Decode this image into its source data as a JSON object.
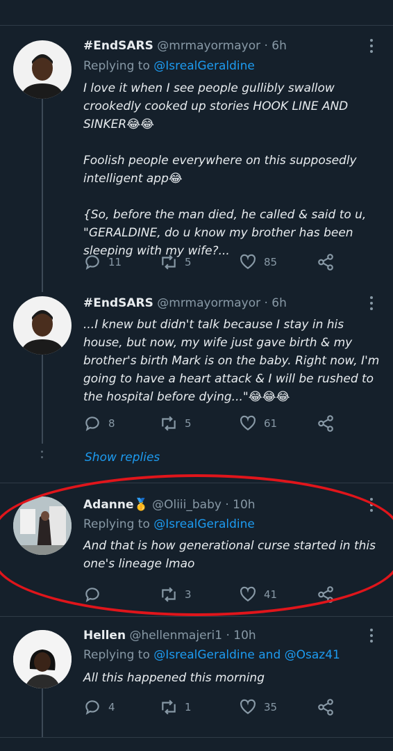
{
  "tweets": [
    {
      "name": "#EndSARS",
      "handle": "@mrmayormayor",
      "time": "· 6h",
      "replying_prefix": "Replying to",
      "replying_to": "@IsrealGeraldine",
      "replying_to_2": "",
      "body": "I love it when I see people gullibly swallow crookedly cooked up stories HOOK LINE AND SINKER😂😂\n\nFoolish people everywhere on this supposedly intelligent app😂\n\n{So, before the man died, he called & said to u, \"GERALDINE, do u know my brother has been sleeping with my wife?...",
      "replies": "11",
      "retweets": "5",
      "likes": "85"
    },
    {
      "name": "#EndSARS",
      "handle": "@mrmayormayor",
      "time": "· 6h",
      "body": "...I knew but didn't talk because I stay in his house, but now, my wife just gave birth & my brother's birth Mark is on the baby. Right now, I'm going to have a heart attack & I will be rushed to the hospital before dying...\"😂😂😂",
      "replies": "8",
      "retweets": "5",
      "likes": "61"
    },
    {
      "name": "Adanne🥇",
      "handle": "@Oliii_baby",
      "time": "· 10h",
      "replying_prefix": "Replying to",
      "replying_to": "@IsrealGeraldine",
      "body": "And that is how generational curse started in this one's lineage lmao",
      "replies": "",
      "retweets": "3",
      "likes": "41"
    },
    {
      "name": "Hellen",
      "handle": "@hellenmajeri1",
      "time": "· 10h",
      "replying_prefix": "Replying to",
      "replying_to": "@IsrealGeraldine",
      "replying_and": "and",
      "replying_to_2": "@Osaz41",
      "body": "All this happened this morning",
      "replies": "4",
      "retweets": "1",
      "likes": "35"
    }
  ],
  "show_replies": "Show replies",
  "icons": {
    "reply": "reply-icon",
    "retweet": "retweet-icon",
    "like": "heart-icon",
    "share": "share-icon",
    "more": "more-icon"
  },
  "colors": {
    "background": "#15202b",
    "link": "#1d9bf0",
    "muted": "#8899a6",
    "highlight": "#e0151b"
  }
}
